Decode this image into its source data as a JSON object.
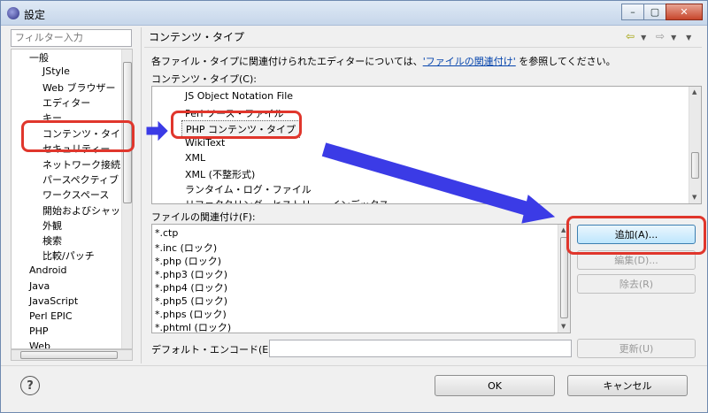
{
  "window": {
    "title": "設定",
    "min_glyph": "–",
    "max_glyph": "▢",
    "close_glyph": "✕"
  },
  "filter": {
    "placeholder": "フィルター入力"
  },
  "tree": {
    "items": [
      "一般",
      "JStyle",
      "Web ブラウザー",
      "エディター",
      "キー",
      "コンテンツ・タイプ",
      "セキュリティー",
      "ネットワーク接続",
      "パースペクティブ",
      "ワークスペース",
      "開始およびシャット",
      "外観",
      "検索",
      "比較/パッチ",
      "Android",
      "Java",
      "JavaScript",
      "Perl EPIC",
      "PHP",
      "Web"
    ]
  },
  "page": {
    "title": "コンテンツ・タイプ",
    "desc_before": "各ファイル・タイプに関連付けられたエディターについては、",
    "desc_link": "'ファイルの関連付け'",
    "desc_after": " を参照してください。",
    "content_types_label": "コンテンツ・タイプ(C):",
    "file_assoc_label": "ファイルの関連付け(F):",
    "encoding_label": "デフォルト・エンコード(E):"
  },
  "content_types": [
    "JS Object Notation File",
    "Perl ソース・ファイル",
    "PHP コンテンツ・タイプ",
    "WikiText",
    "XML",
    "XML (不整形式)",
    "ランタイム・ログ・ファイル",
    "リファクタリング・ヒストリー・インデックス"
  ],
  "file_associations": [
    "*.ctp",
    "*.inc (ロック)",
    "*.php (ロック)",
    "*.php3 (ロック)",
    "*.php4 (ロック)",
    "*.php5 (ロック)",
    "*.phps (ロック)",
    "*.phtml (ロック)"
  ],
  "buttons": {
    "add": "追加(A)...",
    "edit": "編集(D)...",
    "remove": "除去(R)",
    "update": "更新(U)",
    "ok": "OK",
    "cancel": "キャンセル",
    "help": "?"
  },
  "colors": {
    "annotation_red": "#e0362c",
    "annotation_blue": "#3b3be6"
  }
}
